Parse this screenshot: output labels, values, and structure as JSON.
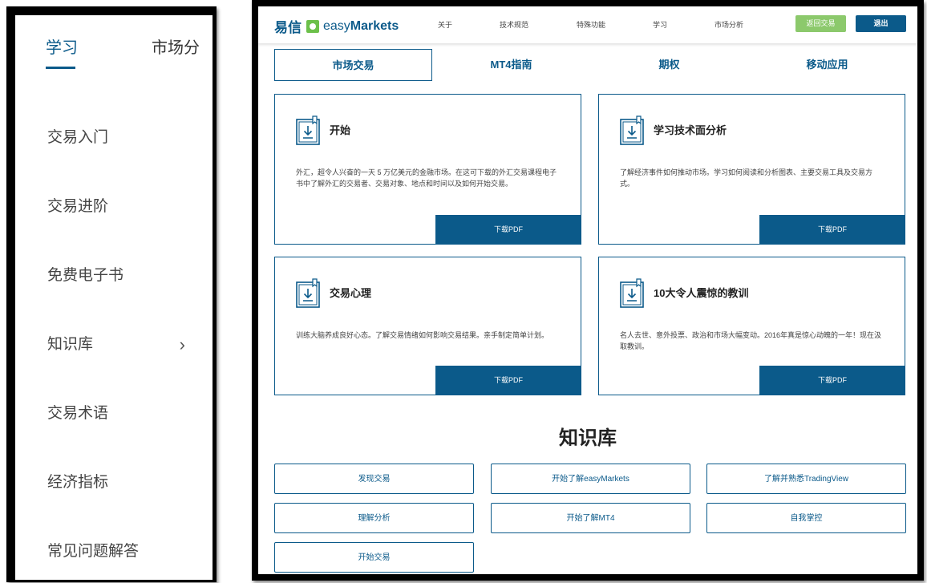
{
  "mobile": {
    "tabs": [
      "学习",
      "市场分"
    ],
    "menu": [
      {
        "label": "交易入门"
      },
      {
        "label": "交易进阶"
      },
      {
        "label": "免费电子书"
      },
      {
        "label": "知识库",
        "chevron": "›"
      },
      {
        "label": "交易术语"
      },
      {
        "label": "经济指标"
      },
      {
        "label": "常见问题解答"
      }
    ]
  },
  "desktop": {
    "logo": {
      "cn": "易信",
      "easy": "easy",
      "markets": "Markets",
      "icon": "easymarkets-logo-icon"
    },
    "nav": [
      "关于",
      "技术规范",
      "特殊功能",
      "学习",
      "市场分析"
    ],
    "nav_buttons": {
      "return": "返回交易",
      "logout": "退出"
    },
    "tabs": [
      "市场交易",
      "MT4指南",
      "期权",
      "移动应用"
    ],
    "active_tab": 0,
    "cards": [
      {
        "title": "开始",
        "desc": "外汇，超令人兴奋的一天 5 万亿美元的金融市场。在这可下载的外汇交易课程电子书中了解外汇的交易者、交易对象、地点和时间以及如何开始交易。",
        "button": "下载PDF",
        "icon": "ebook-download-icon"
      },
      {
        "title": "学习技术面分析",
        "desc": "了解经济事件如何推动市场。学习如何阅读和分析图表、主要交易工具及交易方式。",
        "button": "下载PDF",
        "icon": "ebook-download-icon"
      },
      {
        "title": "交易心理",
        "desc": "训练大脑养成良好心态。了解交易情绪如何影响交易结果。亲手制定简单计划。",
        "button": "下载PDF",
        "icon": "ebook-download-icon"
      },
      {
        "title": "10大令人震惊的教训",
        "desc": "名人去世、意外投票、政治和市场大幅变动。2016年真是惊心动魄的一年！现在汲取教训。",
        "button": "下载PDF",
        "icon": "ebook-download-icon"
      }
    ],
    "knowledge_base": {
      "title": "知识库",
      "links": [
        "发现交易",
        "开始了解easyMarkets",
        "了解并熟悉TradingView",
        "理解分析",
        "开始了解MT4",
        "自我掌控",
        "开始交易"
      ]
    },
    "colors": {
      "brand": "#0b5a8a",
      "green": "#8cc96c"
    }
  }
}
